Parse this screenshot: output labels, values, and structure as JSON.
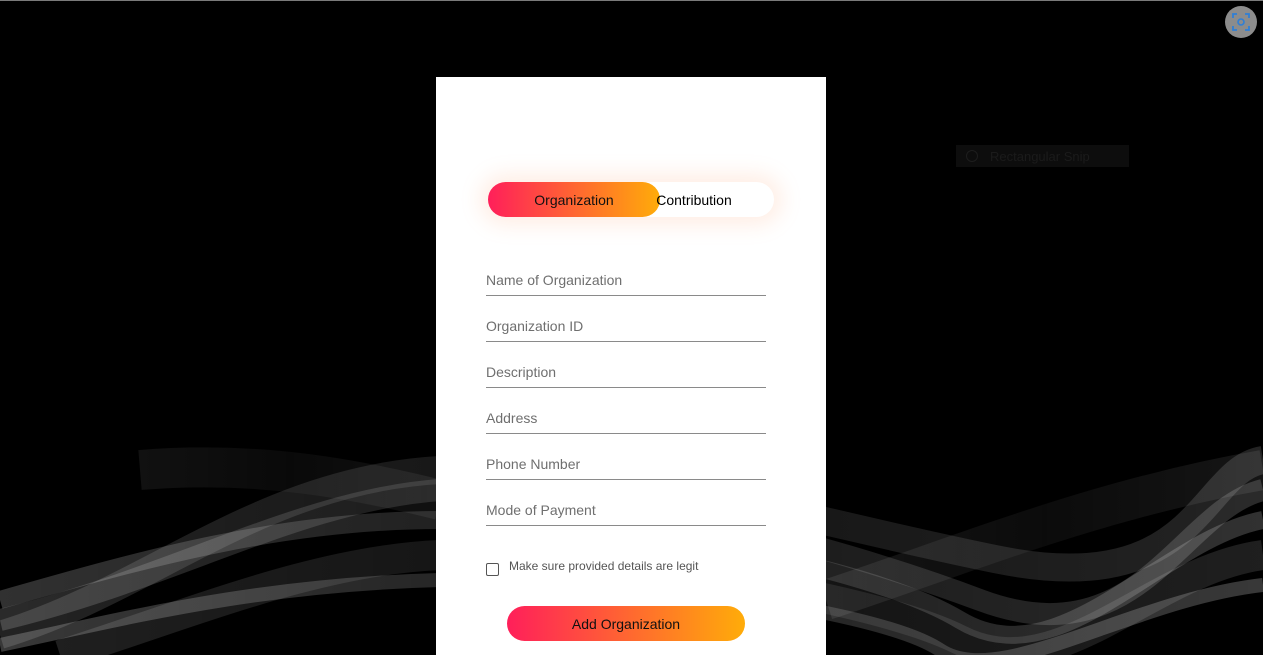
{
  "tabs": {
    "organization_label": "Organization",
    "contribution_label": "Contribution"
  },
  "form": {
    "fields": [
      {
        "placeholder": "Name of Organization",
        "value": ""
      },
      {
        "placeholder": "Organization ID",
        "value": ""
      },
      {
        "placeholder": "Description",
        "value": ""
      },
      {
        "placeholder": "Address",
        "value": ""
      },
      {
        "placeholder": "Phone Number",
        "value": ""
      },
      {
        "placeholder": "Mode of Payment",
        "value": ""
      }
    ],
    "checkbox_label": "Make sure provided details are legit",
    "checkbox_checked": false,
    "submit_label": "Add Organization"
  },
  "overlay": {
    "capture_icon": "screen-capture-icon",
    "tooltip_text": "Rectangular Snip"
  },
  "colors": {
    "gradient_start": "#ff1f5a",
    "gradient_end": "#ffac09",
    "page_background": "#000000",
    "card_background": "#ffffff",
    "capture_icon_accent": "#2f7fd6"
  }
}
